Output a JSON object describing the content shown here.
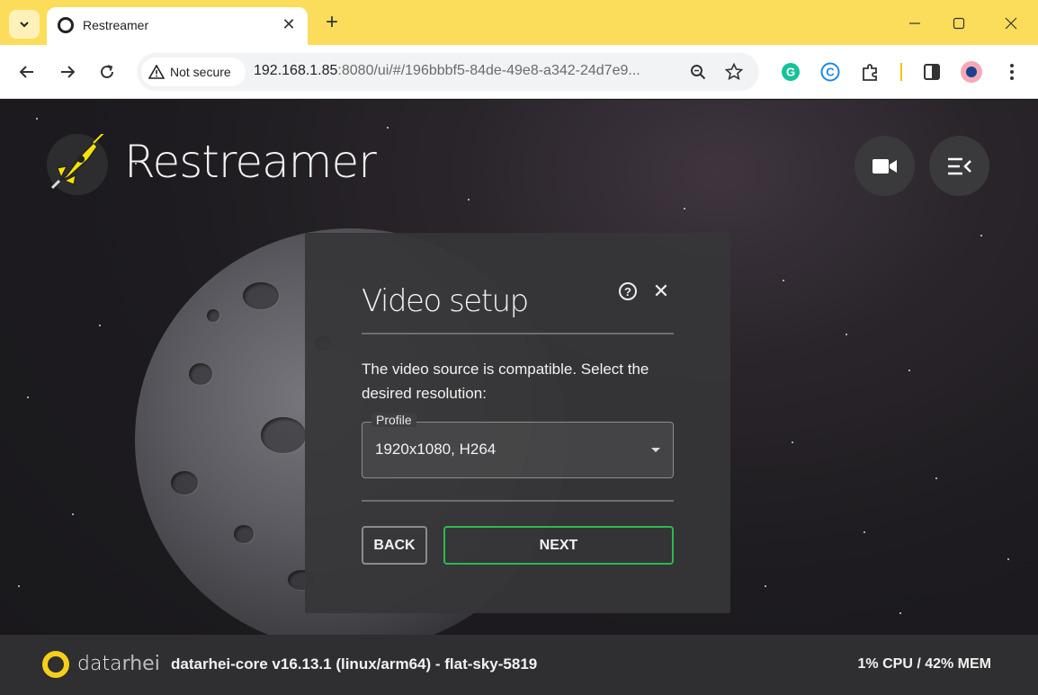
{
  "browser": {
    "tab_title": "Restreamer",
    "security_label": "Not secure",
    "url_host": "192.168.1.85",
    "url_rest": ":8080/ui/#/196bbbf5-84de-49e8-a342-24d7e9...",
    "accent_color": "#fbdd5b"
  },
  "header": {
    "brand": "Restreamer"
  },
  "dialog": {
    "title": "Video setup",
    "description": "The video source is compatible. Select the desired resolution:",
    "profile_label": "Profile",
    "profile_value": "1920x1080, H264",
    "back_label": "BACK",
    "next_label": "NEXT",
    "next_color": "#2db94d"
  },
  "footer": {
    "brand_main": "data",
    "brand_sub": "rhei",
    "version": "datarhei-core v16.13.1 (linux/arm64) - flat-sky-5819",
    "stats": "1% CPU / 42% MEM"
  }
}
